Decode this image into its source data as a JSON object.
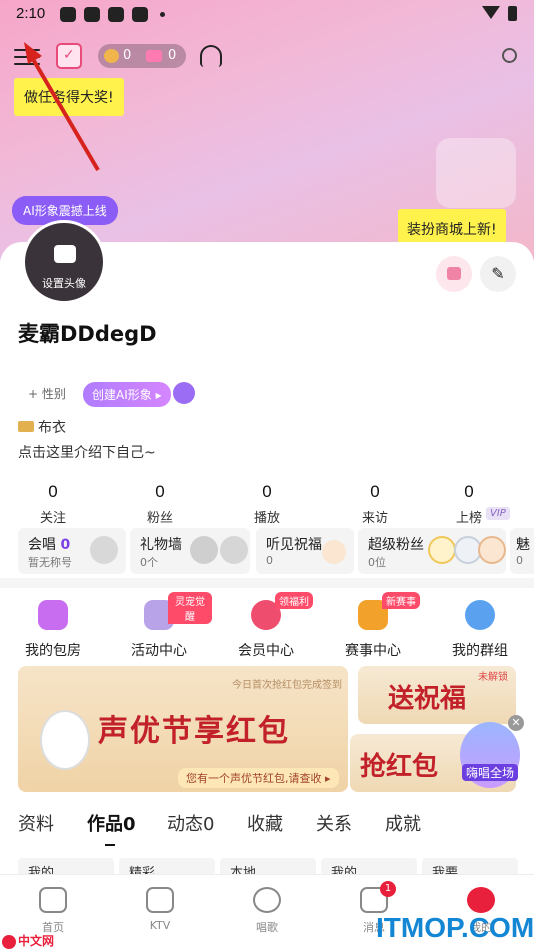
{
  "status_bar": {
    "time": "2:10"
  },
  "header": {
    "coins": [
      "0",
      "0"
    ],
    "tip": "做任务得大奖!"
  },
  "banner_top": {
    "ai_button": "AI形象震撼上线",
    "shop_tip": "装扮商城上新!"
  },
  "profile": {
    "avatar_label": "设置头像",
    "name": "麦霸DDdegD",
    "gender": "+ 性别",
    "create_ai": "创建AI形象 ▸",
    "rank": "布衣",
    "intro": "点击这里介绍下自己~"
  },
  "stats": [
    {
      "value": "0",
      "label": "关注"
    },
    {
      "value": "0",
      "label": "粉丝"
    },
    {
      "value": "0",
      "label": "播放"
    },
    {
      "value": "0",
      "label": "来访"
    },
    {
      "value": "0",
      "label": "上榜"
    }
  ],
  "vip_badge": "VIP",
  "features": [
    {
      "title": "会唱",
      "num": "0",
      "sub": "暂无称号"
    },
    {
      "title": "礼物墙",
      "sub": "0个"
    },
    {
      "title": "听见祝福",
      "sub": "0"
    },
    {
      "title": "超级粉丝",
      "sub": "0位"
    },
    {
      "title": "魅",
      "sub": "0"
    }
  ],
  "grid": [
    {
      "label": "我的包房",
      "tag": "",
      "color": "#c86cf0"
    },
    {
      "label": "活动中心",
      "tag": "灵宠觉醒",
      "color": "#b9a3e8"
    },
    {
      "label": "会员中心",
      "tag": "领福利",
      "color": "#ef4d6e"
    },
    {
      "label": "赛事中心",
      "tag": "新赛事",
      "color": "#f2a22b"
    },
    {
      "label": "我的群组",
      "tag": "",
      "color": "#5aa2f0"
    }
  ],
  "promo": {
    "main_title": "声优节享红包",
    "main_small": "今日首次抢红包完成签到",
    "main_bottom": "您有一个声优节红包,请查收 ▸",
    "side1": "送祝福",
    "side1_tag": "未解锁",
    "side2": "抢红包",
    "float_label": "嗨唱全场"
  },
  "tabs": [
    {
      "label": "资料",
      "active": false
    },
    {
      "label": "作品0",
      "active": true
    },
    {
      "label": "动态0",
      "active": false
    },
    {
      "label": "收藏",
      "active": false
    },
    {
      "label": "关系",
      "active": false
    },
    {
      "label": "成就",
      "active": false
    }
  ],
  "subtabs": [
    "我的",
    "精彩",
    "本地",
    "我的",
    "我要"
  ],
  "nav": [
    {
      "label": "首页",
      "badge": ""
    },
    {
      "label": "KTV",
      "badge": ""
    },
    {
      "label": "唱歌",
      "badge": ""
    },
    {
      "label": "消息",
      "badge": "1"
    },
    {
      "label": "我的",
      "badge": ""
    }
  ],
  "watermarks": {
    "left": "中文网",
    "right": "ITMOP.COM"
  }
}
